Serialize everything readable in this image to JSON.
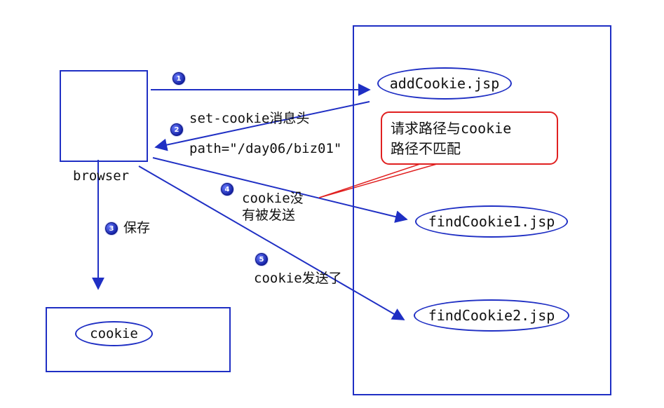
{
  "browser_label": "browser",
  "cookie_label": "cookie",
  "server_pages": {
    "add": "addCookie.jsp",
    "find1": "findCookie1.jsp",
    "find2": "findCookie2.jsp"
  },
  "steps": [
    {
      "num": "1",
      "text": ""
    },
    {
      "num": "2",
      "text": "set-cookie消息头"
    },
    {
      "num": "3",
      "text": "保存"
    },
    {
      "num": "4",
      "text": "cookie没\n有被发送"
    },
    {
      "num": "5",
      "text": "cookie发送了"
    }
  ],
  "path_text": "path=\"/day06/biz01\"",
  "callout_text": "请求路径与cookie\n路径不匹配",
  "colors": {
    "arrow": "#1f2fc4",
    "callout": "#e02020",
    "badge": "#1624a8"
  }
}
